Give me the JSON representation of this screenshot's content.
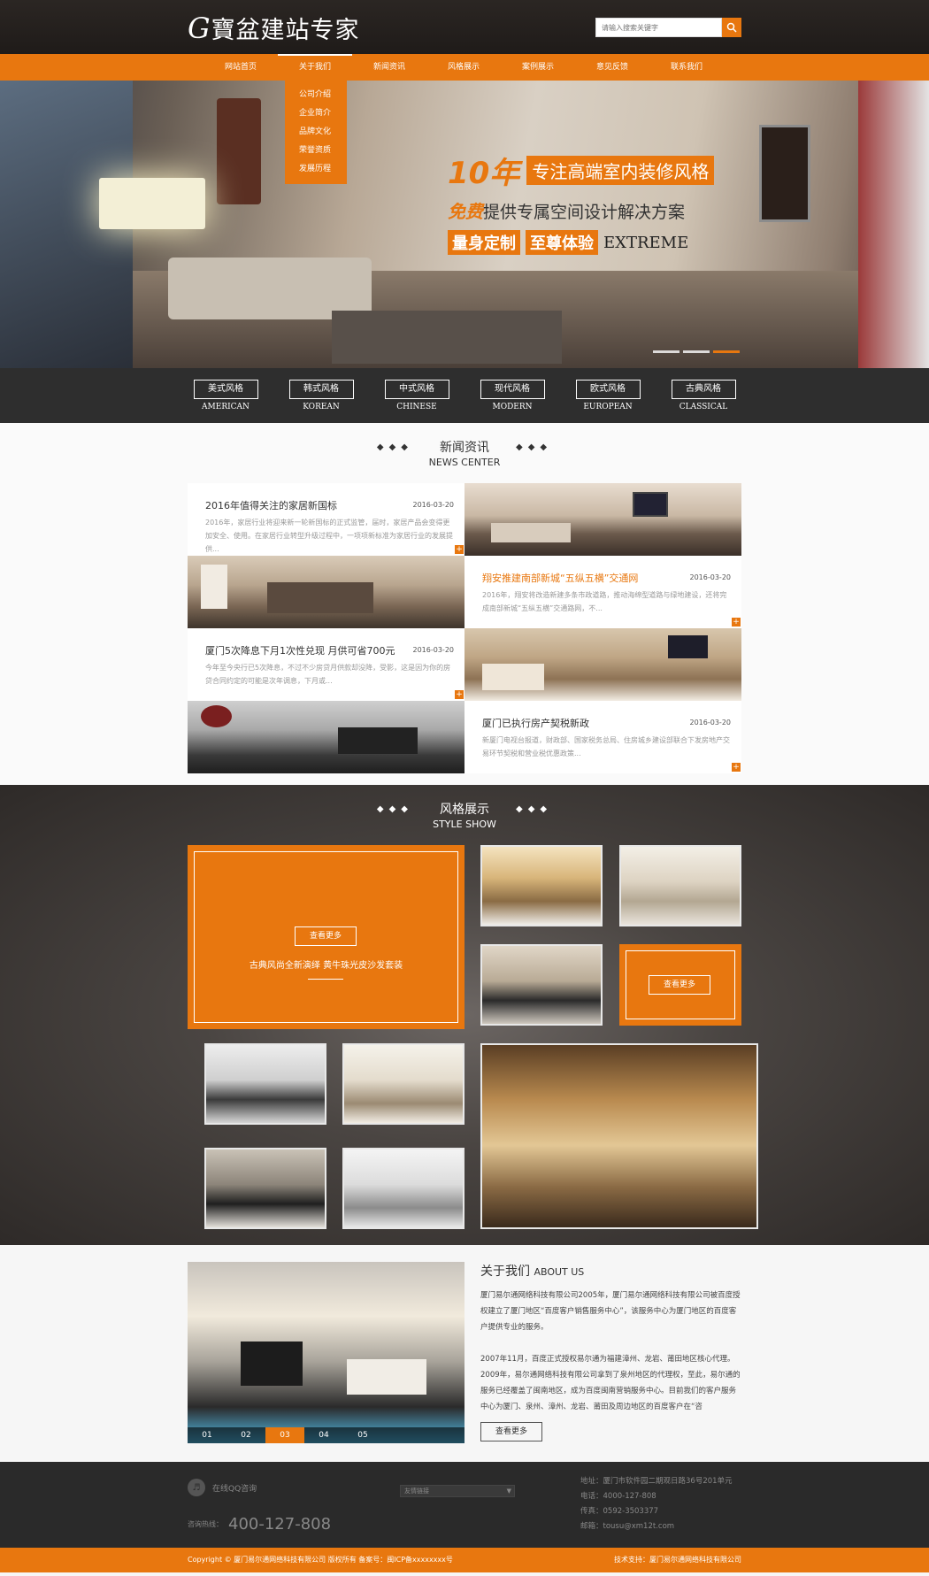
{
  "header": {
    "logo_letter": "G",
    "logo_text": "寶盆建站专家",
    "search_placeholder": "请输入搜索关键字"
  },
  "nav": {
    "items": [
      "网站首页",
      "关于我们",
      "新闻资讯",
      "风格展示",
      "案例展示",
      "意见反馈",
      "联系我们"
    ],
    "dropdown": [
      "公司介绍",
      "企业简介",
      "品牌文化",
      "荣誉资质",
      "发展历程"
    ]
  },
  "banner": {
    "years": "10年",
    "line1": "专注高端室内装修风格",
    "free": "免费",
    "line2": "提供专属空间设计解决方案",
    "line3a": "量身定制",
    "line3b": "至尊体验",
    "line3c": "EXTREME"
  },
  "styles": [
    {
      "cn": "美式风格",
      "en": "AMERICAN"
    },
    {
      "cn": "韩式风格",
      "en": "KOREAN"
    },
    {
      "cn": "中式风格",
      "en": "CHINESE"
    },
    {
      "cn": "现代风格",
      "en": "MODERN"
    },
    {
      "cn": "欧式风格",
      "en": "EUROPEAN"
    },
    {
      "cn": "古典风格",
      "en": "CLASSICAL"
    }
  ],
  "news": {
    "title": "新闻资讯",
    "subtitle": "NEWS CENTER",
    "diamonds": "◆◆◆",
    "items": [
      {
        "title": "2016年值得关注的家居新国标",
        "date": "2016-03-20",
        "text": "2016年，家居行业将迎来新一轮新国标的正式监管，届时，家居产品会变得更加安全、使用。在家居行业转型升级过程中，一项项新标准为家居行业的发展提供..."
      },
      {
        "title": "翔安推建南部新城“五纵五横”交通网",
        "date": "2016-03-20",
        "text": "2016年，翔安将改造新建多条市政道路，推动海绵型道路与绿地建设，还将完成南部新城“五纵五横”交通路网，不..."
      },
      {
        "title": "厦门5次降息下月1次性兑现 月供可省700元",
        "date": "2016-03-20",
        "text": "今年至今央行已5次降息，不过不少房贷月供款却没降，受影，这是因为你的房贷合同约定的可能是次年调息，下月或..."
      },
      {
        "title": "厦门已执行房产契税新政",
        "date": "2016-03-20",
        "text": "新厦门电视台报道，财政部、国家税务总局、住房城乡建设部联合下发房地产交易环节契税和营业税优惠政策..."
      }
    ],
    "plus": "+"
  },
  "show": {
    "title": "风格展示",
    "subtitle": "STYLE SHOW",
    "more": "查看更多",
    "featured": "古典风尚全新演绎 黄牛珠光皮沙发套装"
  },
  "about": {
    "title": "关于我们",
    "title_en": "ABOUT US",
    "p1": "厦门易尔通网络科技有限公司2005年，厦门易尔通网络科技有限公司被百度授权建立了厦门地区“百度客户销售服务中心”，该服务中心为厦门地区的百度客户提供专业的服务。",
    "p2": "2007年11月，百度正式授权易尔通为福建漳州、龙岩、莆田地区核心代理。2009年，易尔通网络科技有限公司拿到了泉州地区的代理权，至此，易尔通的服务已经覆盖了闽南地区，成为百度闽南营销服务中心。目前我们的客户服务中心为厦门、泉州、漳州、龙岩、莆田及周边地区的百度客户在“咨",
    "tabs": [
      "01",
      "02",
      "03",
      "04",
      "05"
    ],
    "more": "查看更多"
  },
  "footer": {
    "qq": "在线QQ咨询",
    "hotline_label": "咨询热线：",
    "hotline": "400-127-808",
    "links": "友情链接",
    "address": "地址：厦门市软件园二期观日路36号201单元",
    "phone": "电话：4000-127-808",
    "fax": "传真：0592-3503377",
    "email": "邮箱：tousu@xm12t.com",
    "copyright": "Copyright © 厦门易尔通网络科技有限公司 版权所有   备案号：闽ICP备xxxxxxxx号",
    "support": "技术支持：厦门易尔通网络科技有限公司"
  },
  "colors": {
    "accent": "#e8770f",
    "dark": "#2e2e2e"
  }
}
